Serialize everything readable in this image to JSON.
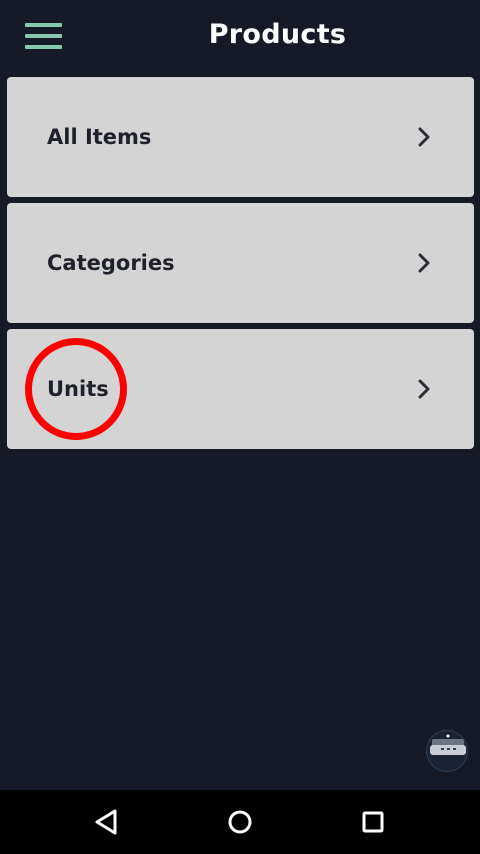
{
  "app_bar": {
    "title": "Products",
    "menu_icon": "hamburger-menu-icon",
    "accent_color": "#86c7ae"
  },
  "menu": {
    "items": [
      {
        "label": "All Items",
        "icon": "chevron-right-icon"
      },
      {
        "label": "Categories",
        "icon": "chevron-right-icon"
      },
      {
        "label": "Units",
        "icon": "chevron-right-icon",
        "highlighted": true
      }
    ]
  },
  "floating_button": {
    "icon": "floating-assistant-icon"
  },
  "nav_bar": {
    "back_icon": "back-triangle-icon",
    "home_icon": "home-circle-icon",
    "recents_icon": "recents-square-icon"
  },
  "colors": {
    "background": "#151a26",
    "card": "#d4d4d4",
    "highlight": "#ff0000"
  }
}
